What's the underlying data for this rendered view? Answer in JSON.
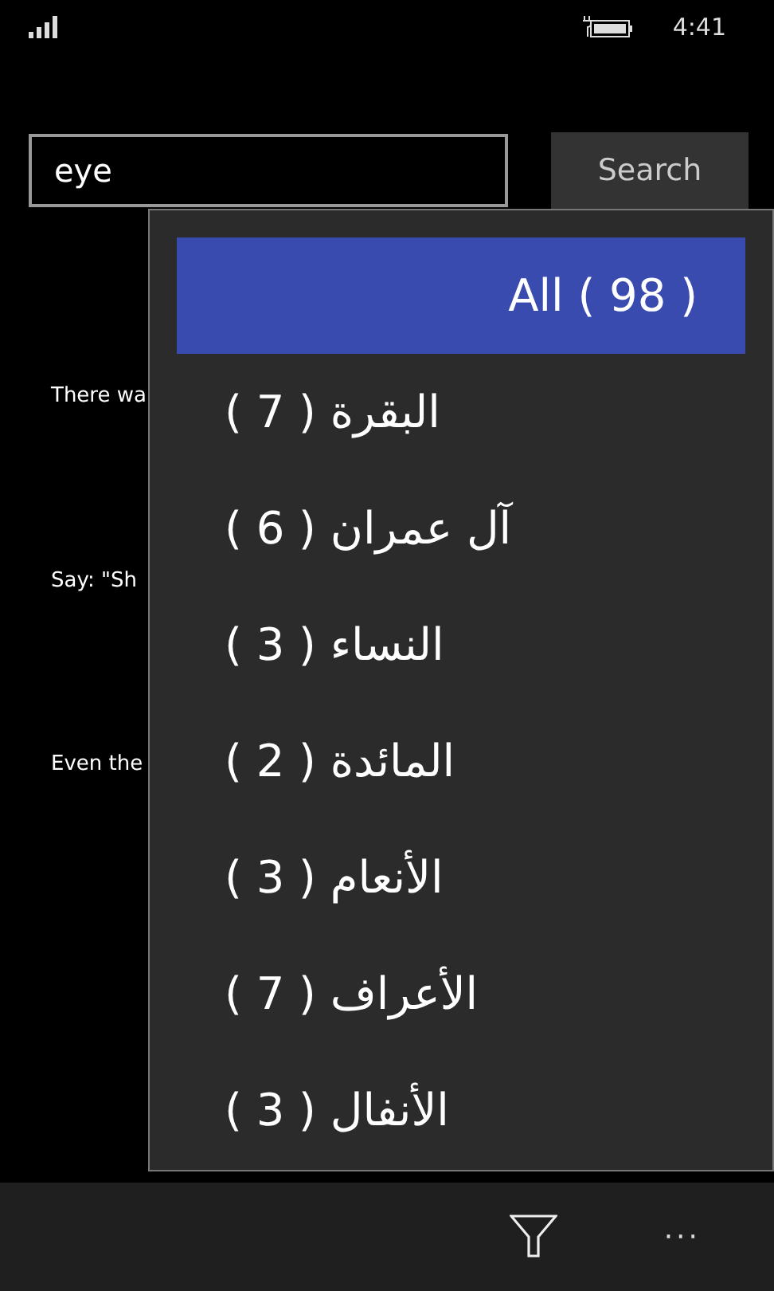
{
  "status_bar": {
    "time": "4:41"
  },
  "search": {
    "value": "eye",
    "button": "Search"
  },
  "results": [
    {
      "text": "There wa"
    },
    {
      "text": "Say: \"Sh"
    },
    {
      "text": "Even the"
    }
  ],
  "dropdown": {
    "items": [
      {
        "label": "All ( 98 )",
        "selected": true
      },
      {
        "label": "البقرة ( 7 )",
        "selected": false
      },
      {
        "label": "آل عمران ( 6 )",
        "selected": false
      },
      {
        "label": "النساء ( 3 )",
        "selected": false
      },
      {
        "label": "المائدة ( 2 )",
        "selected": false
      },
      {
        "label": "الأنعام ( 3 )",
        "selected": false
      },
      {
        "label": "الأعراف ( 7 )",
        "selected": false
      },
      {
        "label": "الأنفال ( 3 )",
        "selected": false
      }
    ]
  },
  "app_bar": {
    "more": "···"
  }
}
